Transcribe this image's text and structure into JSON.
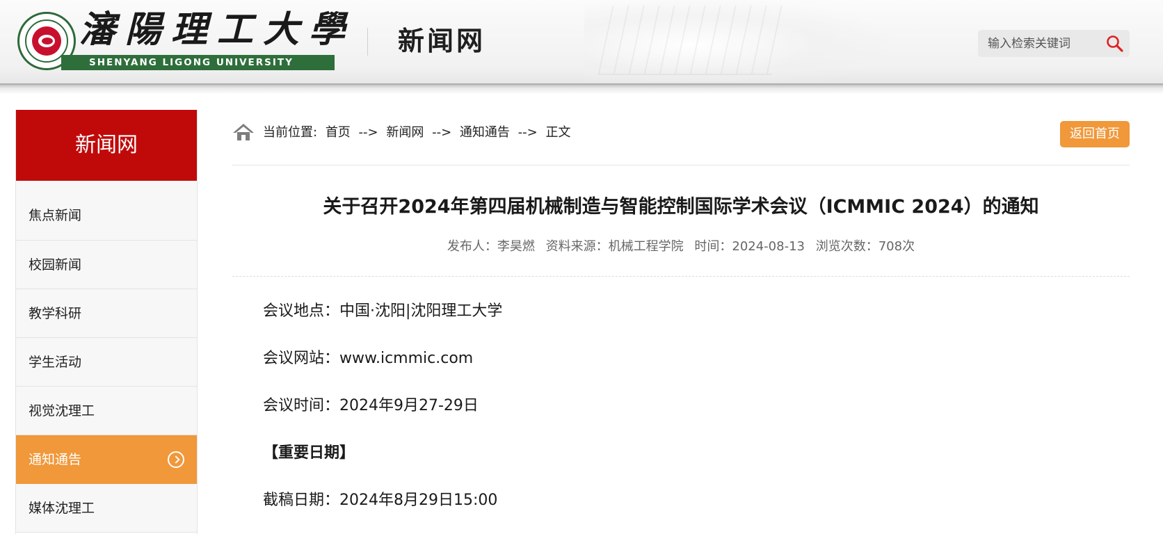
{
  "header": {
    "logo_cn": "瀋陽理工大學",
    "logo_en": "SHENYANG LIGONG UNIVERSITY",
    "site_name": "新闻网",
    "search_placeholder": "输入检索关键词"
  },
  "sidebar": {
    "title": "新闻网",
    "items": [
      {
        "label": "焦点新闻"
      },
      {
        "label": "校园新闻"
      },
      {
        "label": "教学科研"
      },
      {
        "label": "学生活动"
      },
      {
        "label": "视觉沈理工"
      },
      {
        "label": "通知通告",
        "active": true
      },
      {
        "label": "媒体沈理工"
      }
    ]
  },
  "breadcrumb": {
    "prefix": "当前位置:",
    "items": [
      "首页",
      "-->",
      "新闻网",
      "-->",
      "通知通告",
      "-->",
      "正文"
    ]
  },
  "back_button": "返回首页",
  "article": {
    "title": "关于召开2024年第四届机械制造与智能控制国际学术会议（ICMMIC 2024）的通知",
    "meta": {
      "publisher": "发布人：李昊燃",
      "source": "资料来源：机械工程学院",
      "time": "时间：2024-08-13",
      "views": "浏览次数：708次"
    },
    "paragraphs": [
      {
        "text": "会议地点：中国·沈阳|沈阳理工大学",
        "bold": false
      },
      {
        "text": "会议网站：www.icmmic.com",
        "bold": false
      },
      {
        "text": "会议时间：2024年9月27-29日",
        "bold": false
      },
      {
        "text": "【重要日期】",
        "bold": true
      },
      {
        "text": "截稿日期：2024年8月29日15:00",
        "bold": false
      }
    ]
  },
  "colors": {
    "brand_red": "#c00a0a",
    "accent_orange": "#f0983a",
    "logo_green": "#2e6e3a"
  },
  "icons": {
    "search": "search-icon",
    "home": "home-icon",
    "arrow": "chevron-right-circle-icon"
  }
}
